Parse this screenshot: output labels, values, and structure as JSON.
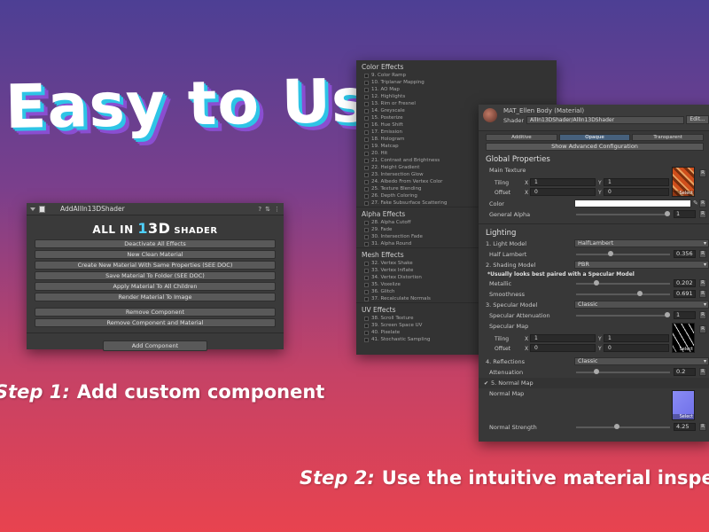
{
  "headline": "Easy to Use",
  "steps": [
    {
      "number": "Step 1:",
      "text": "Add custom component"
    },
    {
      "number": "Step 2:",
      "text": "Use the intuitive material inspect"
    }
  ],
  "component": {
    "title": "AddAllIn13DShader",
    "header_icons": [
      "?",
      "⇅",
      "⋮"
    ],
    "logo": {
      "part1": "ALL IN ",
      "part2": "1",
      "part3": "3D",
      "part4": " SHADER"
    },
    "buttons": [
      "Deactivate All Effects",
      "New Clean Material",
      "Create New Material With Same Properties (SEE DOC)",
      "Save Material To Folder (SEE DOC)",
      "Apply Material To All Children",
      "Render Material To Image"
    ],
    "buttons2": [
      "Remove Component",
      "Remove Component and Material"
    ],
    "add_component": "Add Component"
  },
  "effects": [
    {
      "heading": "Color Effects",
      "items": [
        "9. Color Ramp",
        "10. Triplanar Mapping",
        "11. AO Map",
        "12. Highlights",
        "13. Rim or Fresnel",
        "14. Greyscale",
        "15. Posterize",
        "16. Hue Shift",
        "17. Emission",
        "18. Hologram",
        "19. Matcap",
        "20. Hit",
        "21. Contrast and Brightness",
        "22. Height Gradient",
        "23. Intersection Glow",
        "24. Albedo From Vertex Color",
        "25. Texture Blending",
        "26. Depth Coloring",
        "27. Fake Subsurface Scattering"
      ]
    },
    {
      "heading": "Alpha Effects",
      "items": [
        "28. Alpha Cutoff",
        "29. Fade",
        "30. Intersection Fade",
        "31. Alpha Round"
      ]
    },
    {
      "heading": "Mesh Effects",
      "items": [
        "32. Vertex Shake",
        "33. Vertex Inflate",
        "34. Vertex Distortion",
        "35. Voxelize",
        "36. Glitch",
        "37. Recalculate Normals"
      ]
    },
    {
      "heading": "UV Effects",
      "items": [
        "38. Scroll Texture",
        "39. Screen Space UV",
        "40. Pixelate",
        "41. Stochastic Sampling"
      ]
    }
  ],
  "material": {
    "title": "MAT_Ellen Body (Material)",
    "shader_label": "Shader",
    "shader_value": "AllIn13DShader/AllIn13DShader",
    "edit": "Edit...",
    "modes": [
      {
        "label": "Additive",
        "active": false
      },
      {
        "label": "Opaque",
        "active": true
      },
      {
        "label": "Transparent",
        "active": false
      }
    ],
    "advanced": "Show Advanced Configuration",
    "global_heading": "Global Properties",
    "main_texture": "Main Texture",
    "tiling": "Tiling",
    "offset": "Offset",
    "x": "X",
    "y": "Y",
    "main_tiling": [
      "1",
      "1"
    ],
    "main_offset": [
      "0",
      "0"
    ],
    "color": "Color",
    "general_alpha": "General Alpha",
    "general_alpha_value": "1",
    "general_alpha_frac": 1.0,
    "lighting_heading": "Lighting",
    "light_model_label": "1. Light Model",
    "light_model": "HalfLambert",
    "half_lambert_label": "Half Lambert",
    "half_lambert_value": "0.356",
    "half_lambert_frac": 0.356,
    "shading_label": "2. Shading Model",
    "shading": "PBR",
    "pbr_note": "*Usually looks best paired with a Specular Model",
    "metallic_label": "Metallic",
    "metallic_value": "0.202",
    "metallic_frac": 0.202,
    "smoothness_label": "Smoothness",
    "smoothness_value": "0.691",
    "smoothness_frac": 0.691,
    "specular_label": "3. Specular Model",
    "specular": "Classic",
    "spec_atten_label": "Specular Attenuation",
    "spec_atten_value": "1",
    "spec_atten_frac": 1.0,
    "spec_map": "Specular Map",
    "spec_tiling": [
      "1",
      "1"
    ],
    "spec_offset": [
      "0",
      "0"
    ],
    "reflections_label": "4. Reflections",
    "reflections": "Classic",
    "atten_label": "Attenuation",
    "atten_value": "0.2",
    "atten_frac": 0.2,
    "normal_heading": "5. Normal Map",
    "normal_map": "Normal Map",
    "normal_strength_label": "Normal Strength",
    "normal_strength_value": "4.25",
    "normal_strength_frac": 0.425,
    "r": "R",
    "select": "Select"
  },
  "colors": {
    "accent": "#46607c",
    "cyan": "#2ec4e6",
    "purple": "#8a4ed1"
  }
}
